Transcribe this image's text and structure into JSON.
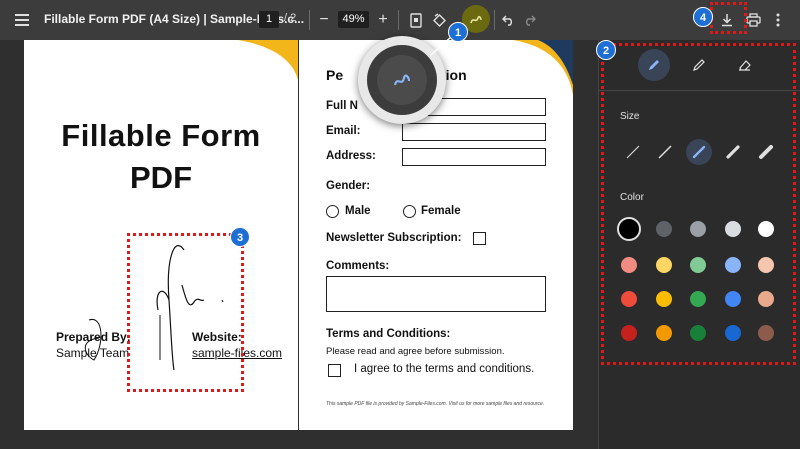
{
  "toolbar": {
    "title": "Fillable Form PDF (A4 Size) | Sample-Files.c...",
    "current_page": "1",
    "page_total": "/  2",
    "zoom": "49%",
    "zoom_out": "−",
    "zoom_in": "+"
  },
  "page1": {
    "heading_line1": "Fillable Form",
    "heading_line2": "PDF",
    "prepared_label": "Prepared By:",
    "prepared_value": "Sample Team",
    "website_label": "Website:",
    "website_value": "sample-files.com"
  },
  "page2": {
    "section_title_left": "Pe",
    "section_title_right": "tion",
    "full_name": "Full N",
    "email": "Email:",
    "address": "Address:",
    "gender": "Gender:",
    "male": "Male",
    "female": "Female",
    "newsletter": "Newsletter Subscription:",
    "comments": "Comments:",
    "terms_title": "Terms and Conditions:",
    "terms_text": "Please read and agree before submission.",
    "agree": "I agree to the terms and conditions.",
    "footer": "This sample PDF file is provided by Sample-Files.com. Visit us for more sample files and resource."
  },
  "sidebar": {
    "size_label": "Size",
    "color_label": "Color",
    "colors_row1": [
      "#000000",
      "#5f6368",
      "#9aa0a6",
      "#dadce0",
      "#ffffff"
    ],
    "colors_row2": [
      "#f28b82",
      "#fdd663",
      "#81c995",
      "#8ab4f8",
      "#f6c7ae"
    ],
    "colors_row3": [
      "#ee4b3b",
      "#fbbc04",
      "#34a853",
      "#4285f4",
      "#e8a98c"
    ],
    "colors_row4": [
      "#c5221f",
      "#f29900",
      "#188038",
      "#1967d2",
      "#8d5b4c"
    ]
  },
  "badges": {
    "b1": "1",
    "b2": "2",
    "b3": "3",
    "b4": "4"
  },
  "colors": {
    "accent": "#1d6fd6",
    "callout": "#e01818",
    "page_accent": "#f2b51a",
    "page_corner": "#1e3a5f"
  }
}
